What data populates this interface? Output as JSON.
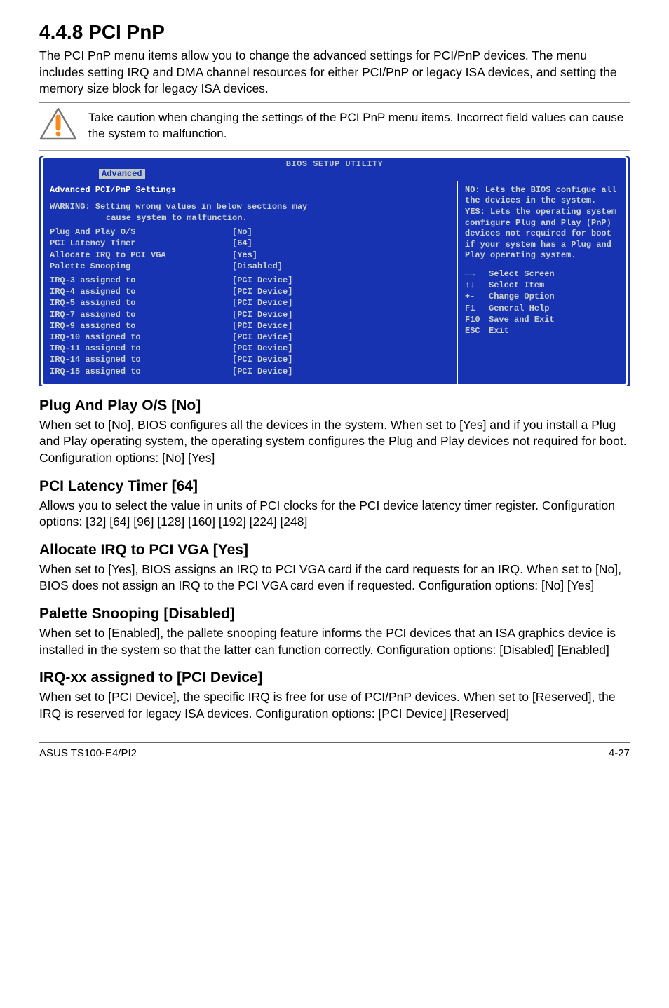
{
  "section": {
    "number": "4.4.8",
    "title": "PCI PnP",
    "intro": "The PCI PnP menu items allow you to change the advanced settings for PCI/PnP devices. The menu includes setting IRQ and DMA channel resources for either PCI/PnP or legacy ISA devices, and setting the memory size block for legacy ISA devices."
  },
  "note": "Take caution when changing the settings of the PCI PnP menu items. Incorrect field values can cause the system to malfunction.",
  "bios": {
    "title": "BIOS SETUP UTILITY",
    "tab": "Advanced",
    "left_header": "Advanced PCI/PnP Settings",
    "warning_line1": "WARNING: Setting wrong values in below sections may",
    "warning_line2": "cause system to malfunction.",
    "group1": [
      {
        "label": "Plug And Play O/S",
        "value": "[No]"
      },
      {
        "label": "PCI Latency Timer",
        "value": "[64]"
      },
      {
        "label": "Allocate IRQ to PCI VGA",
        "value": "[Yes]"
      },
      {
        "label": "Palette Snooping",
        "value": "[Disabled]"
      }
    ],
    "group2": [
      {
        "label": "IRQ-3 assigned to",
        "value": "[PCI Device]"
      },
      {
        "label": "IRQ-4 assigned to",
        "value": "[PCI Device]"
      },
      {
        "label": "IRQ-5 assigned to",
        "value": "[PCI Device]"
      },
      {
        "label": "IRQ-7 assigned to",
        "value": "[PCI Device]"
      },
      {
        "label": "IRQ-9 assigned to",
        "value": "[PCI Device]"
      },
      {
        "label": "IRQ-10 assigned to",
        "value": "[PCI Device]"
      },
      {
        "label": "IRQ-11 assigned to",
        "value": "[PCI Device]"
      },
      {
        "label": "IRQ-14 assigned to",
        "value": "[PCI Device]"
      },
      {
        "label": "IRQ-15 assigned to",
        "value": "[PCI Device]"
      }
    ],
    "help1": "NO: Lets the BIOS configue all the devices in the system.",
    "help2": "YES: Lets the operating system configure Plug and Play (PnP) devices not required for boot if your system has a Plug and Play operating system.",
    "legend": [
      {
        "key": "←→",
        "text": "Select Screen"
      },
      {
        "key": "↑↓",
        "text": "Select Item"
      },
      {
        "key": "+-",
        "text": "Change Option"
      },
      {
        "key": "F1",
        "text": "General Help"
      },
      {
        "key": "F10",
        "text": "Save and Exit"
      },
      {
        "key": "ESC",
        "text": "Exit"
      }
    ]
  },
  "subsections": [
    {
      "heading": "Plug And Play O/S [No]",
      "body": "When set to [No], BIOS configures all the devices in the system. When set to [Yes] and if you install a Plug and Play operating system, the operating system configures the Plug and Play devices not required for boot. Configuration options: [No] [Yes]"
    },
    {
      "heading": "PCI Latency Timer [64]",
      "body": "Allows you to select the value in units of PCI clocks for the PCI device latency timer register. Configuration options: [32] [64] [96] [128] [160] [192] [224] [248]"
    },
    {
      "heading": "Allocate IRQ to PCI VGA [Yes]",
      "body": "When set to [Yes], BIOS assigns an IRQ to PCI VGA card if the card requests for an IRQ. When set to [No], BIOS does not assign an IRQ to the PCI VGA card even if requested. Configuration options: [No] [Yes]"
    },
    {
      "heading": "Palette Snooping [Disabled]",
      "body": "When set to [Enabled], the pallete snooping feature informs the PCI devices that an ISA graphics device is installed in the system so that the latter can function correctly. Configuration options: [Disabled] [Enabled]"
    },
    {
      "heading": "IRQ-xx assigned to [PCI Device]",
      "body": "When set to [PCI Device], the specific IRQ is free for use of PCI/PnP devices. When set to [Reserved], the IRQ is reserved for legacy ISA devices. Configuration options: [PCI Device] [Reserved]"
    }
  ],
  "footer": {
    "left": "ASUS TS100-E4/PI2",
    "right": "4-27"
  }
}
